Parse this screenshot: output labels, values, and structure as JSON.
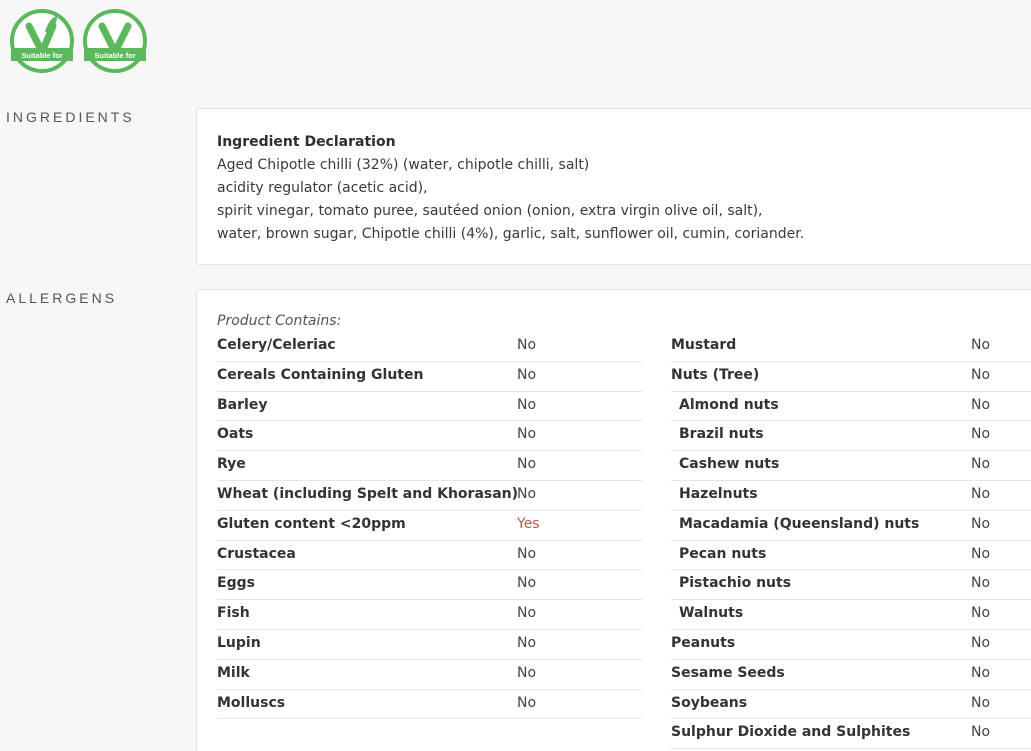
{
  "colors": {
    "badge_green": "#5cb85c",
    "yes_color": "#c0504d"
  },
  "badges": [
    {
      "icon": "vegetarian-badge-icon",
      "text": "Suitable for"
    },
    {
      "icon": "vegan-badge-icon",
      "text": "Suitable for"
    }
  ],
  "ingredients": {
    "section_label": "INGREDIENTS",
    "title": "Ingredient Declaration",
    "lines": [
      "Aged Chipotle chilli (32%) (water, chipotle chilli, salt)",
      "acidity regulator (acetic acid),",
      "spirit vinegar, tomato puree, sautéed onion (onion, extra virgin olive oil, salt),",
      "water, brown sugar, Chipotle chilli (4%), garlic, salt, sunflower oil, cumin, coriander."
    ]
  },
  "allergens": {
    "section_label": "ALLERGENS",
    "contains_label": "Product Contains:",
    "left": [
      {
        "name": "Celery/Celeriac",
        "value": "No"
      },
      {
        "name": "Cereals Containing Gluten",
        "value": "No"
      },
      {
        "name": "Barley",
        "value": "No"
      },
      {
        "name": "Oats",
        "value": "No"
      },
      {
        "name": "Rye",
        "value": "No"
      },
      {
        "name": "Wheat (including Spelt and Khorasan)",
        "value": "No"
      },
      {
        "name": "Gluten content <20ppm",
        "value": "Yes"
      },
      {
        "name": "Crustacea",
        "value": "No"
      },
      {
        "name": "Eggs",
        "value": "No"
      },
      {
        "name": "Fish",
        "value": "No"
      },
      {
        "name": "Lupin",
        "value": "No"
      },
      {
        "name": "Milk",
        "value": "No"
      },
      {
        "name": "Molluscs",
        "value": "No"
      }
    ],
    "right": [
      {
        "name": "Mustard",
        "value": "No"
      },
      {
        "name": "Nuts (Tree)",
        "value": "No"
      },
      {
        "name": "Almond nuts",
        "value": "No",
        "sub": true
      },
      {
        "name": "Brazil nuts",
        "value": "No",
        "sub": true
      },
      {
        "name": "Cashew nuts",
        "value": "No",
        "sub": true
      },
      {
        "name": "Hazelnuts",
        "value": "No",
        "sub": true
      },
      {
        "name": "Macadamia (Queensland) nuts",
        "value": "No",
        "sub": true
      },
      {
        "name": "Pecan nuts",
        "value": "No",
        "sub": true
      },
      {
        "name": "Pistachio nuts",
        "value": "No",
        "sub": true
      },
      {
        "name": "Walnuts",
        "value": "No",
        "sub": true
      },
      {
        "name": "Peanuts",
        "value": "No"
      },
      {
        "name": "Sesame Seeds",
        "value": "No"
      },
      {
        "name": "Soybeans",
        "value": "No"
      },
      {
        "name": "Sulphur Dioxide and Sulphites",
        "value": "No"
      }
    ]
  }
}
